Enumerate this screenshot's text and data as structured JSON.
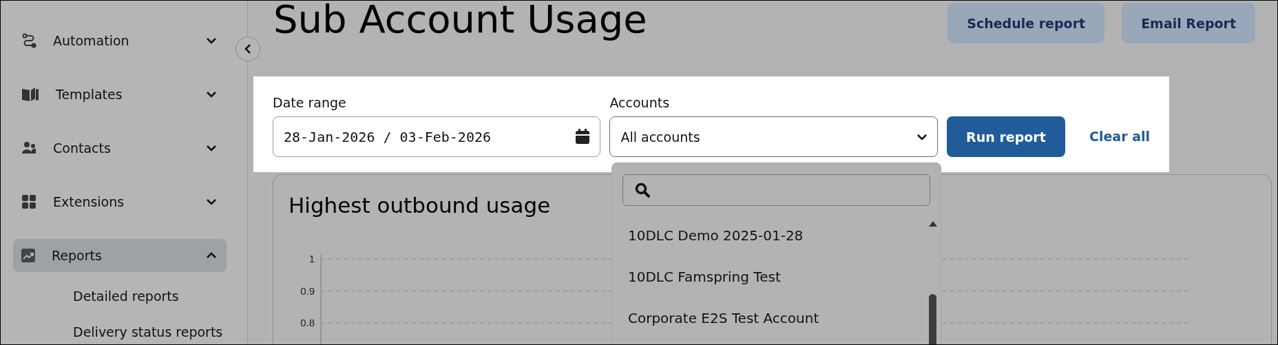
{
  "sidebar": {
    "items": [
      {
        "label": "Automation",
        "expanded": false,
        "selected": false
      },
      {
        "label": "Templates",
        "expanded": false,
        "selected": false
      },
      {
        "label": "Contacts",
        "expanded": false,
        "selected": false
      },
      {
        "label": "Extensions",
        "expanded": false,
        "selected": false
      },
      {
        "label": "Reports",
        "expanded": true,
        "selected": true,
        "children": [
          {
            "label": "Detailed reports"
          },
          {
            "label": "Delivery status reports"
          }
        ]
      }
    ]
  },
  "page": {
    "title": "Sub Account Usage",
    "actions": [
      "Schedule report",
      "Email Report"
    ]
  },
  "filters": {
    "date_range": {
      "label": "Date range",
      "value": "28-Jan-2026 / 03-Feb-2026"
    },
    "accounts": {
      "label": "Accounts",
      "value": "All accounts",
      "expanded": true,
      "options": [
        "10DLC Demo 2025-01-28",
        "10DLC Famspring Test",
        "Corporate E2S Test Account"
      ]
    },
    "run": "Run report",
    "clear": "Clear all"
  },
  "chart": {
    "title": "Highest outbound usage",
    "y_axis_labels": [
      "1",
      "0.9",
      "0.8"
    ]
  }
}
